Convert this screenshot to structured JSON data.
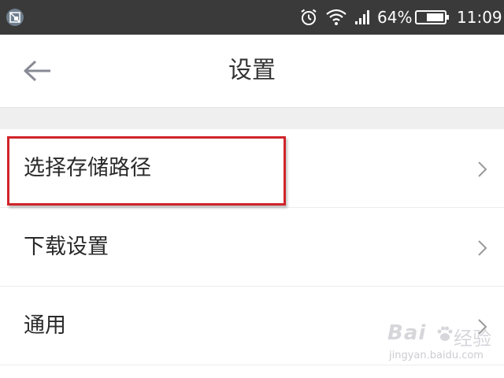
{
  "status_bar": {
    "battery_percent": "64%",
    "time": "11:09",
    "icons": [
      "app-notification-icon",
      "alarm-icon",
      "wifi-icon",
      "signal-icon",
      "battery-icon"
    ]
  },
  "header": {
    "back_icon": "arrow-left-icon",
    "title": "设置"
  },
  "settings": {
    "items": [
      {
        "label": "选择存储路径",
        "icon": "chevron-right-icon"
      },
      {
        "label": "下载设置",
        "icon": "chevron-right-icon"
      },
      {
        "label": "通用",
        "icon": "chevron-right-icon"
      }
    ]
  },
  "annotation": {
    "highlight_color": "#d0242a"
  },
  "watermark": {
    "logo": "Bai",
    "brand": "经验",
    "url": "jingyan.baidu.com"
  }
}
